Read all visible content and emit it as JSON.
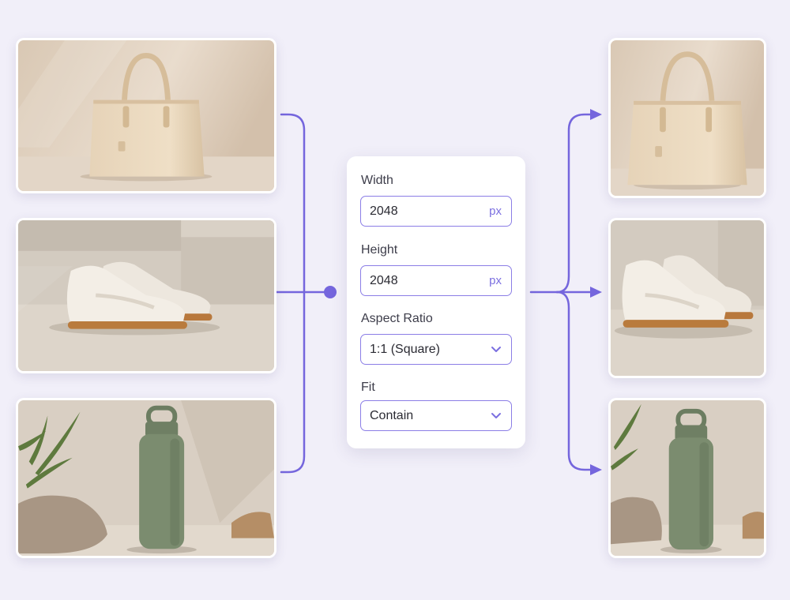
{
  "settings": {
    "width": {
      "label": "Width",
      "value": "2048",
      "unit": "px"
    },
    "height": {
      "label": "Height",
      "value": "2048",
      "unit": "px"
    },
    "aspect_ratio": {
      "label": "Aspect Ratio",
      "value": "1:1 (Square)"
    },
    "fit": {
      "label": "Fit",
      "value": "Contain"
    }
  },
  "inputs": [
    {
      "subject": "handbag"
    },
    {
      "subject": "sneakers"
    },
    {
      "subject": "water-bottle"
    }
  ],
  "outputs": [
    {
      "subject": "handbag"
    },
    {
      "subject": "sneakers"
    },
    {
      "subject": "water-bottle"
    }
  ],
  "colors": {
    "accent": "#7b6fe0",
    "background": "#f1eff9",
    "connector": "#7566dd"
  },
  "icons": {
    "dropdown": "chevron-down-icon",
    "node": "junction-dot-icon",
    "arrow": "arrow-right-icon"
  }
}
